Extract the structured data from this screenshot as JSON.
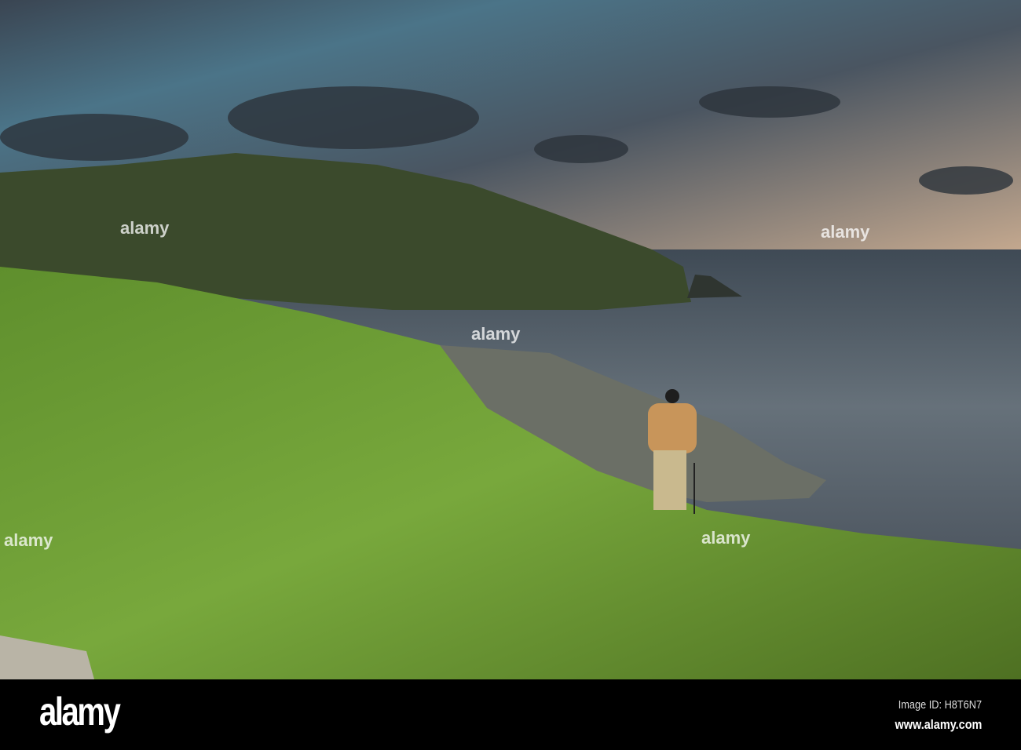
{
  "photo": {
    "subject": "",
    "colors": {
      "sky_top": "#3a4450",
      "sky_blue": "#4f7f95",
      "sky_warm": "#c9a98a",
      "sea": "#4a5560",
      "grass": "#6a9a35",
      "cliff": "#3b4a2c",
      "jacket": "#c8955a"
    }
  },
  "watermark": {
    "text": "alamy"
  },
  "footer": {
    "logo": "alamy",
    "image_id": "Image ID: H8T6N7",
    "website": "www.alamy.com"
  }
}
